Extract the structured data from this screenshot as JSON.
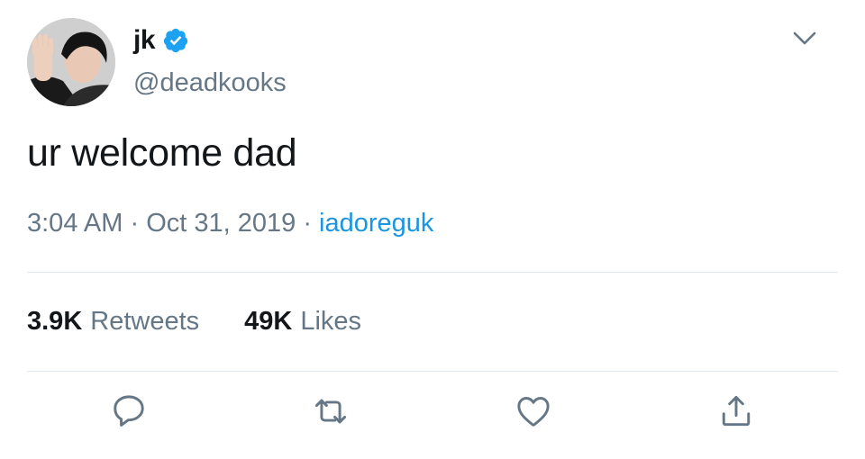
{
  "author": {
    "display_name": "jk",
    "handle": "@deadkooks",
    "verified": true,
    "avatar_icon": "profile-photo"
  },
  "tweet": {
    "text": "ur welcome dad",
    "time": "3:04 AM",
    "separator": "·",
    "date": "Oct 31, 2019",
    "source": "iadoreguk"
  },
  "stats": {
    "retweets_count": "3.9K",
    "retweets_label": "Retweets",
    "likes_count": "49K",
    "likes_label": "Likes"
  },
  "actions": [
    {
      "name": "reply",
      "icon": "speech-bubble-icon"
    },
    {
      "name": "retweet",
      "icon": "retweet-icon"
    },
    {
      "name": "like",
      "icon": "heart-icon"
    },
    {
      "name": "share",
      "icon": "share-icon"
    }
  ],
  "colors": {
    "text_primary": "#14171a",
    "text_secondary": "#657786",
    "link": "#1b95e0",
    "verified_badge": "#1da1f2",
    "divider": "#e1e8ed"
  }
}
